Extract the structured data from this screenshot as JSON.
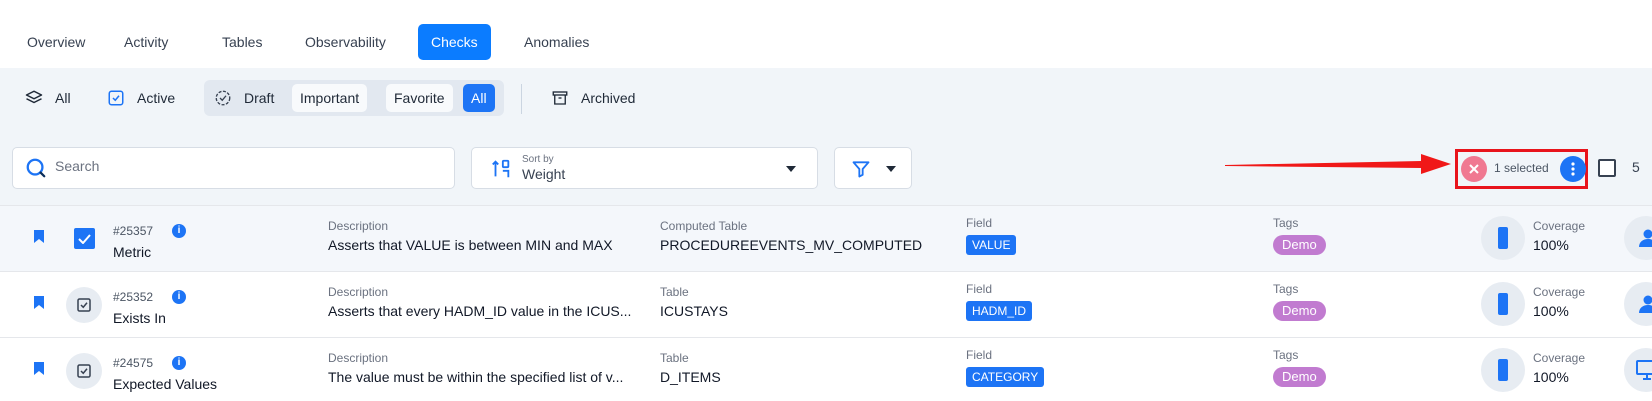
{
  "tabs": [
    {
      "label": "Overview"
    },
    {
      "label": "Activity"
    },
    {
      "label": "Tables"
    },
    {
      "label": "Observability"
    },
    {
      "label": "Checks",
      "active": true
    },
    {
      "label": "Anomalies"
    }
  ],
  "filters": {
    "all": "All",
    "active": "Active",
    "draft": "Draft",
    "important": "Important",
    "favorite": "Favorite",
    "draft_all": "All",
    "archived": "Archived"
  },
  "search": {
    "placeholder": "Search"
  },
  "sort": {
    "caption": "Sort by",
    "value": "Weight"
  },
  "selection": {
    "text": "1 selected",
    "count": "5"
  },
  "colors": {
    "accent": "#1d74f5",
    "tag": "#c17bd0",
    "highlight": "#e8141c"
  },
  "rows": [
    {
      "id": "#25357",
      "name": "Metric",
      "selected": true,
      "icon": "checkbox-checked-icon",
      "desc_label": "Description",
      "description": "Asserts that VALUE is between MIN and MAX",
      "table_label": "Computed Table",
      "table": "PROCEDUREEVENTS_MV_COMPUTED",
      "field_label": "Field",
      "field": "VALUE",
      "tags_label": "Tags",
      "tag": "Demo",
      "coverage_label": "Coverage",
      "coverage": "100%",
      "coverage_fraction": 1.0,
      "owner_icon": "user-icon"
    },
    {
      "id": "#25352",
      "name": "Exists In",
      "selected": false,
      "icon": "check-clipboard-icon",
      "desc_label": "Description",
      "description": "Asserts that every HADM_ID value in the ICUS...",
      "table_label": "Table",
      "table": "ICUSTAYS",
      "field_label": "Field",
      "field": "HADM_ID",
      "tags_label": "Tags",
      "tag": "Demo",
      "coverage_label": "Coverage",
      "coverage": "100%",
      "coverage_fraction": 1.0,
      "owner_icon": "user-icon"
    },
    {
      "id": "#24575",
      "name": "Expected Values",
      "selected": false,
      "icon": "check-clipboard-icon",
      "desc_label": "Description",
      "description": "The value must be within the specified list of v...",
      "table_label": "Table",
      "table": "D_ITEMS",
      "field_label": "Field",
      "field": "CATEGORY",
      "tags_label": "Tags",
      "tag": "Demo",
      "coverage_label": "Coverage",
      "coverage": "100%",
      "coverage_fraction": 1.0,
      "owner_icon": "monitor-icon"
    }
  ]
}
